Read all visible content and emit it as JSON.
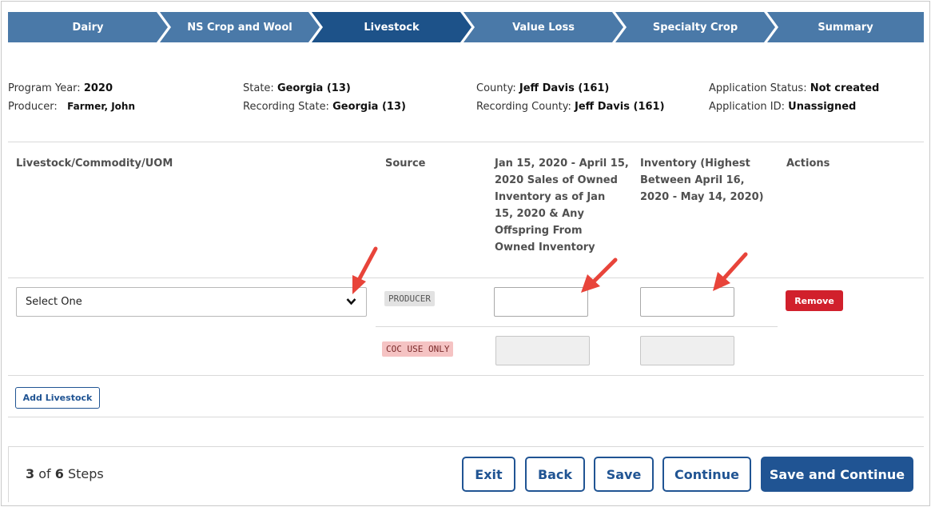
{
  "stepper": {
    "steps": [
      "Dairy",
      "NS Crop and Wool",
      "Livestock",
      "Value Loss",
      "Specialty Crop",
      "Summary"
    ],
    "active_index": 2,
    "colors": {
      "inactive": "#4a79a8",
      "active": "#1d5289"
    }
  },
  "info": {
    "program_year_label": "Program Year:",
    "program_year": "2020",
    "producer_label": "Producer:",
    "producer": "Farmer, John",
    "state_label": "State:",
    "state": "Georgia (13)",
    "recording_state_label": "Recording State:",
    "recording_state": "Georgia (13)",
    "county_label": "County:",
    "county": "Jeff Davis (161)",
    "recording_county_label": "Recording County:",
    "recording_county": "Jeff Davis (161)",
    "app_status_label": "Application Status:",
    "app_status": "Not created",
    "app_id_label": "Application ID:",
    "app_id": "Unassigned"
  },
  "table": {
    "headers": {
      "livestock": "Livestock/Commodity/UOM",
      "source": "Source",
      "sales": [
        "Jan 15, 2020 - April 15,",
        "2020 Sales of Owned",
        "Inventory as of Jan",
        "15, 2020 & Any",
        "Offspring From",
        "Owned Inventory"
      ],
      "inventory": [
        "Inventory (Highest",
        "Between April 16,",
        "2020 - May 14, 2020)"
      ],
      "actions": "Actions"
    },
    "row": {
      "select_value": "Select One",
      "source_producer": "PRODUCER",
      "source_coc": "COC USE ONLY",
      "remove_label": "Remove"
    },
    "add_label": "Add Livestock"
  },
  "footer": {
    "current_step": "3",
    "of": "of",
    "total_steps": "6",
    "steps_word": "Steps",
    "buttons": {
      "exit": "Exit",
      "back": "Back",
      "save": "Save",
      "continue": "Continue",
      "save_continue": "Save and Continue"
    }
  },
  "annotation_color": "#e8443a"
}
